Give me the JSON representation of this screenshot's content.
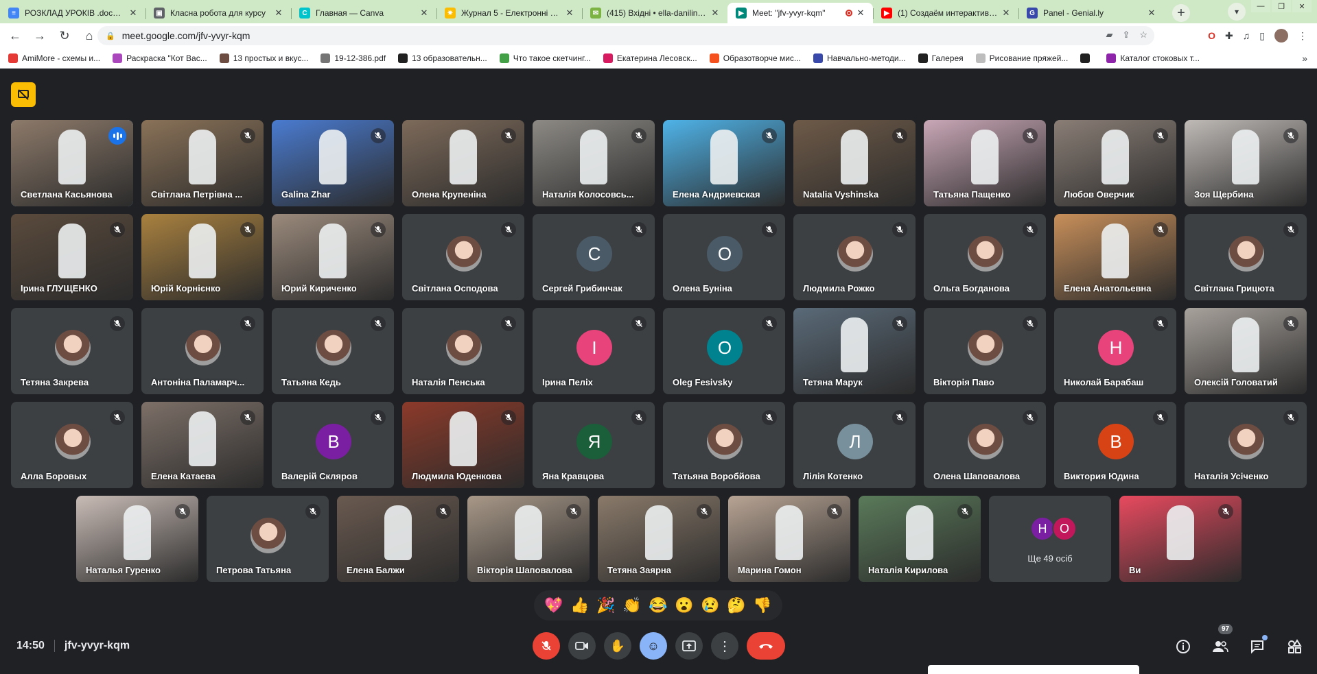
{
  "tabs": [
    {
      "title": "РОЗКЛАД УРОКІВ .docx - G",
      "color": "#4285f4",
      "glyph": "≡"
    },
    {
      "title": "Класна робота для курсу ",
      "color": "#5f6368",
      "glyph": "▣"
    },
    {
      "title": "Главная — Canva",
      "color": "#00c4cc",
      "glyph": "C"
    },
    {
      "title": "Журнал 5 - Електронні що",
      "color": "#fbbc04",
      "glyph": "✷"
    },
    {
      "title": "(415) Вхідні • ella-danilina@",
      "color": "#7cb342",
      "glyph": "✉"
    },
    {
      "title": "Meet: \"jfv-yvyr-kqm\"",
      "color": "#00897b",
      "glyph": "▶"
    },
    {
      "title": "(1) Создаём интерактивны",
      "color": "#ff0000",
      "glyph": "▶"
    },
    {
      "title": "Panel - Genial.ly",
      "color": "#3949ab",
      "glyph": "G"
    }
  ],
  "url": "meet.google.com/jfv-yvyr-kqm",
  "bookmarks": [
    {
      "label": "AmiMore - схемы и...",
      "color": "#e53935"
    },
    {
      "label": "Раскраска \"Кот Вас...",
      "color": "#ab47bc"
    },
    {
      "label": "13 простых и вкус...",
      "color": "#6d4c41"
    },
    {
      "label": "19-12-386.pdf",
      "color": "#757575"
    },
    {
      "label": "13 образовательн...",
      "color": "#212121"
    },
    {
      "label": "Что такое скетчинг...",
      "color": "#43a047"
    },
    {
      "label": "Екатерина Лесовск...",
      "color": "#d81b60"
    },
    {
      "label": "Образотворче мис...",
      "color": "#f4511e"
    },
    {
      "label": "Навчально-методи...",
      "color": "#3949ab"
    },
    {
      "label": "Галерея",
      "color": "#212121"
    },
    {
      "label": "Рисование пряжей...",
      "color": "#bdbdbd"
    },
    {
      "label": "",
      "color": "#212121"
    },
    {
      "label": "Каталог стоковых т...",
      "color": "#8e24aa"
    }
  ],
  "participants": [
    {
      "name": "Светлана Касьянова",
      "kind": "video",
      "bg": "#8d7a6a",
      "speaking": true
    },
    {
      "name": "Світлана Петрівна ...",
      "kind": "video",
      "bg": "#8a7258"
    },
    {
      "name": "Galina Zhar",
      "kind": "video",
      "bg": "#4a7bd0"
    },
    {
      "name": "Олена Крупеніна",
      "kind": "video",
      "bg": "#7d6a5a"
    },
    {
      "name": "Наталія Колосовсь...",
      "kind": "video",
      "bg": "#8d8a85"
    },
    {
      "name": "Елена Андриевская",
      "kind": "video",
      "bg": "#4fb3e8"
    },
    {
      "name": "Natalia Vyshinska",
      "kind": "video",
      "bg": "#6e5a48"
    },
    {
      "name": "Татьяна Пащенко",
      "kind": "video",
      "bg": "#c9a7b6"
    },
    {
      "name": "Любов Оверчик",
      "kind": "video",
      "bg": "#8a7e76"
    },
    {
      "name": "Зоя Щербина",
      "kind": "video",
      "bg": "#bfbab6"
    },
    {
      "name": "Ірина ГЛУЩЕНКО",
      "kind": "video",
      "bg": "#5a4a3c"
    },
    {
      "name": "Юрій Корнієнко",
      "kind": "video",
      "bg": "#a9813f"
    },
    {
      "name": "Юрий Кириченко",
      "kind": "video",
      "bg": "#9b8a7c"
    },
    {
      "name": "Світлана Осподова",
      "kind": "photo"
    },
    {
      "name": "Сергей Грибинчак",
      "kind": "letter",
      "letter": "С",
      "color": "#4a5a66"
    },
    {
      "name": "Олена Буніна",
      "kind": "letter",
      "letter": "О",
      "color": "#4a5a66"
    },
    {
      "name": "Людмила Рожко",
      "kind": "photo"
    },
    {
      "name": "Ольга Богданова",
      "kind": "photo"
    },
    {
      "name": "Елена Анатольевна",
      "kind": "video",
      "bg": "#c88f5a"
    },
    {
      "name": "Світлана Грицюта",
      "kind": "photo"
    },
    {
      "name": "Тетяна Закрева",
      "kind": "photo"
    },
    {
      "name": "Антоніна Паламарч...",
      "kind": "photo"
    },
    {
      "name": "Татьяна Кедь",
      "kind": "photo"
    },
    {
      "name": "Наталія Пенська",
      "kind": "photo"
    },
    {
      "name": "Ірина Пеліх",
      "kind": "letter",
      "letter": "І",
      "color": "#e8437a"
    },
    {
      "name": "Oleg Fesivsky",
      "kind": "letter",
      "letter": "O",
      "color": "#00838f"
    },
    {
      "name": "Тетяна Марук",
      "kind": "video",
      "bg": "#5a6a78"
    },
    {
      "name": "Вікторія Паво",
      "kind": "photo"
    },
    {
      "name": "Николай Барабаш",
      "kind": "letter",
      "letter": "Н",
      "color": "#e8437a"
    },
    {
      "name": "Олексій Головатий",
      "kind": "video",
      "bg": "#a8a29c"
    },
    {
      "name": "Алла Боровых",
      "kind": "photo"
    },
    {
      "name": "Елена Катаева",
      "kind": "video",
      "bg": "#7d7068"
    },
    {
      "name": "Валерій Скляров",
      "kind": "letter",
      "letter": "В",
      "color": "#7b1fa2"
    },
    {
      "name": "Людмила Юденкова",
      "kind": "video",
      "bg": "#8c3a2a"
    },
    {
      "name": "Яна Кравцова",
      "kind": "letter",
      "letter": "Я",
      "color": "#1b5e3a"
    },
    {
      "name": "Татьяна Воробйова",
      "kind": "photo"
    },
    {
      "name": "Лілія Котенко",
      "kind": "letter",
      "letter": "Л",
      "color": "#78909c"
    },
    {
      "name": "Олена Шаповалова",
      "kind": "photo"
    },
    {
      "name": "Виктория Юдина",
      "kind": "letter",
      "letter": "В",
      "color": "#d84315"
    },
    {
      "name": "Наталія Усіченко",
      "kind": "photo"
    },
    {
      "name": "Наталья Гуренко",
      "kind": "video",
      "bg": "#c9bcb6"
    },
    {
      "name": "Петрова Татьяна",
      "kind": "photo"
    },
    {
      "name": "Елена Балжи",
      "kind": "video",
      "bg": "#6a5a50"
    },
    {
      "name": "Вікторія Шаповалова",
      "kind": "video",
      "bg": "#a89888"
    },
    {
      "name": "Тетяна Заярна",
      "kind": "video",
      "bg": "#8a7a6a"
    },
    {
      "name": "Марина Гомон",
      "kind": "video",
      "bg": "#b8a494"
    },
    {
      "name": "Наталія Кирилова",
      "kind": "video",
      "bg": "#5a7a5a"
    },
    {
      "name": "",
      "kind": "more",
      "label": "Ще 49 осіб",
      "avatars": [
        {
          "letter": "Н",
          "color": "#7b1fa2"
        },
        {
          "letter": "О",
          "color": "#c2185b"
        }
      ]
    },
    {
      "name": "Ви",
      "kind": "video",
      "bg": "#e84a5f"
    }
  ],
  "reactions": [
    "💖",
    "👍",
    "🎉",
    "👏",
    "😂",
    "😮",
    "😢",
    "🤔",
    "👎"
  ],
  "clock": "14:50",
  "meeting_code": "jfv-yvyr-kqm",
  "people_count": "97"
}
